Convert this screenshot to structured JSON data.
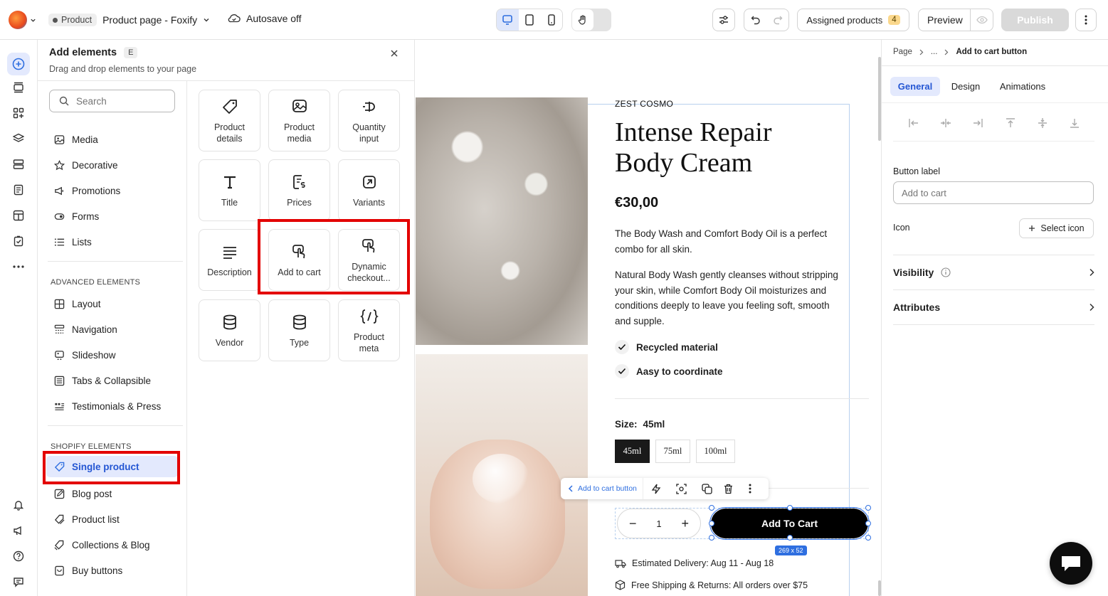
{
  "topbar": {
    "product_tag": "Product",
    "page_name": "Product page - Foxify",
    "autosave": "Autosave off",
    "assigned": "Assigned products",
    "assigned_count": "4",
    "preview": "Preview",
    "publish": "Publish"
  },
  "panel": {
    "title": "Add elements",
    "shortcut": "E",
    "subtitle": "Drag and drop elements to your page",
    "search_placeholder": "Search",
    "categories": [
      {
        "label": "Media",
        "icon": "image-icon"
      },
      {
        "label": "Decorative",
        "icon": "star-icon"
      },
      {
        "label": "Promotions",
        "icon": "megaphone-icon"
      },
      {
        "label": "Forms",
        "icon": "form-icon"
      },
      {
        "label": "Lists",
        "icon": "list-icon"
      }
    ],
    "advanced_header": "ADVANCED ELEMENTS",
    "advanced": [
      {
        "label": "Layout"
      },
      {
        "label": "Navigation"
      },
      {
        "label": "Slideshow"
      },
      {
        "label": "Tabs & Collapsible"
      },
      {
        "label": "Testimonials & Press"
      }
    ],
    "shopify_header": "SHOPIFY ELEMENTS",
    "shopify": [
      {
        "label": "Single product"
      },
      {
        "label": "Blog post"
      },
      {
        "label": "Product list"
      },
      {
        "label": "Collections & Blog"
      },
      {
        "label": "Buy buttons"
      }
    ],
    "tiles": [
      {
        "l1": "Product",
        "l2": "details"
      },
      {
        "l1": "Product",
        "l2": "media"
      },
      {
        "l1": "Quantity",
        "l2": "input"
      },
      {
        "l1": "Title",
        "l2": ""
      },
      {
        "l1": "Prices",
        "l2": ""
      },
      {
        "l1": "Variants",
        "l2": ""
      },
      {
        "l1": "Description",
        "l2": ""
      },
      {
        "l1": "Add to cart",
        "l2": ""
      },
      {
        "l1": "Dynamic",
        "l2": "checkout..."
      },
      {
        "l1": "Vendor",
        "l2": ""
      },
      {
        "l1": "Type",
        "l2": ""
      },
      {
        "l1": "Product",
        "l2": "meta"
      }
    ]
  },
  "product": {
    "brand": "ZEST COSMO",
    "title1": "Intense Repair",
    "title2": "Body Cream",
    "price": "€30,00",
    "desc1a": "The Body Wash and Comfort Body Oil is a perfect",
    "desc1b": "combo for all skin.",
    "desc2a": "Natural Body Wash gently cleanses without stripping",
    "desc2b": "your skin, while Comfort Body Oil moisturizes and",
    "desc2c": "conditions deeply to leave you feeling soft, smooth",
    "desc2d": "and supple.",
    "feature1": "Recycled material",
    "feature2": "Aasy to coordinate",
    "size_label": "Size:",
    "size_value": "45ml",
    "sizes": [
      "45ml",
      "75ml",
      "100ml"
    ],
    "qty": "1",
    "add_to_cart": "Add To Cart",
    "dims": "269 x 52",
    "toolbar_label": "Add to cart button",
    "delivery": "Estimated Delivery: Aug 11 - Aug 18",
    "shipping": "Free Shipping & Returns: All orders over $75"
  },
  "right": {
    "crumb1": "Page",
    "crumb2": "...",
    "crumb3": "Add to cart button",
    "tab_general": "General",
    "tab_design": "Design",
    "tab_animations": "Animations",
    "button_label": "Button label",
    "button_placeholder": "Add to cart",
    "icon_label": "Icon",
    "select_icon": "Select icon",
    "visibility": "Visibility",
    "attributes": "Attributes"
  },
  "colors": {
    "accent": "#2f6fe0",
    "selected_bg": "#e3e9fd",
    "highlight": "#e30000",
    "publish_bg": "#d9d9d9"
  }
}
